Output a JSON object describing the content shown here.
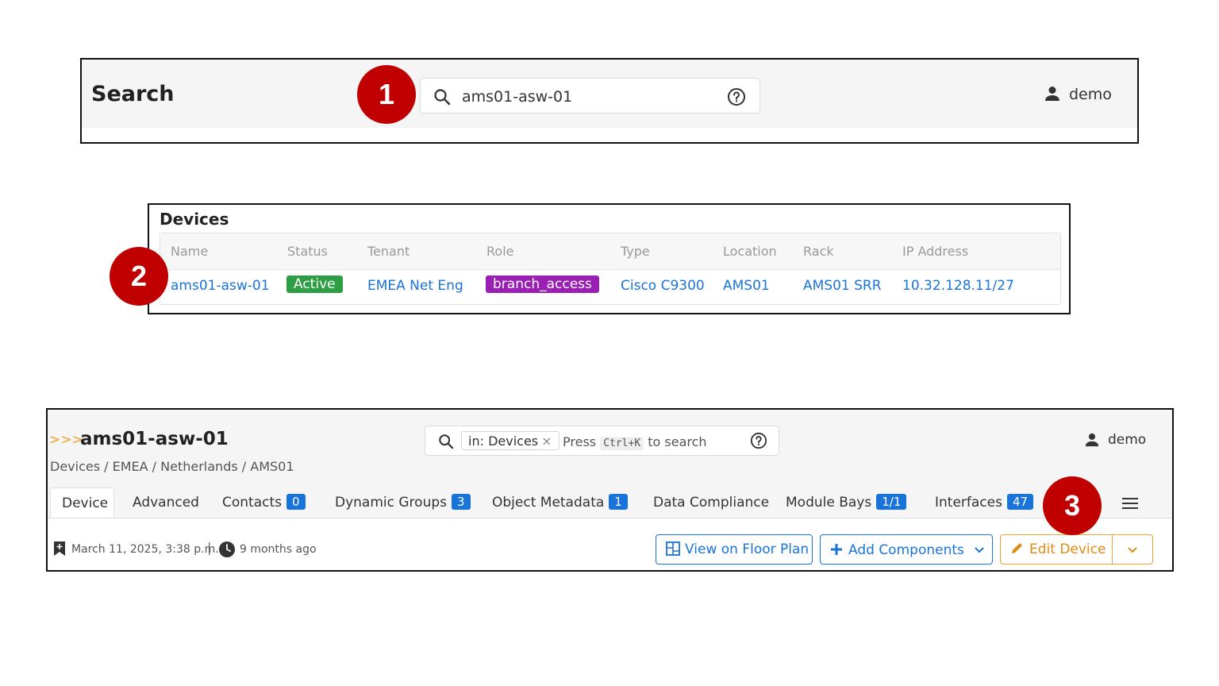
{
  "markers": [
    "1",
    "2",
    "3"
  ],
  "search_page": {
    "title": "Search",
    "search_value": "ams01-asw-01",
    "user": "demo"
  },
  "devices_table": {
    "title": "Devices",
    "columns": [
      "Name",
      "Status",
      "Tenant",
      "Role",
      "Type",
      "Location",
      "Rack",
      "IP Address"
    ],
    "row": {
      "name": "ams01-asw-01",
      "status": "Active",
      "tenant": "EMEA Net Eng",
      "role": "branch_access",
      "type": "Cisco C9300",
      "location": "AMS01",
      "rack": "AMS01 SRR",
      "ip_address": "10.32.128.11/27"
    }
  },
  "device_page": {
    "chevrons": ">>>",
    "title": "ams01-asw-01",
    "breadcrumb": "Devices / EMEA / Netherlands / AMS01",
    "search": {
      "chip": "in: Devices",
      "chip_close": "×",
      "hint_press": "Press",
      "hint_key": "Ctrl+K",
      "hint_rest": "to search"
    },
    "user": "demo",
    "tabs": [
      {
        "label": "Device",
        "count": null
      },
      {
        "label": "Advanced",
        "count": null
      },
      {
        "label": "Contacts",
        "count": "0"
      },
      {
        "label": "Dynamic Groups",
        "count": "3"
      },
      {
        "label": "Object Metadata",
        "count": "1"
      },
      {
        "label": "Data Compliance",
        "count": null
      },
      {
        "label": "Module Bays",
        "count": "1/1"
      },
      {
        "label": "Interfaces",
        "count": "47"
      }
    ],
    "created": "March 11, 2025, 3:38 p.m.",
    "separator": "|",
    "updated": "9 months ago",
    "buttons": {
      "floor_plan": "View on Floor Plan",
      "add_components": "Add Components",
      "edit_device": "Edit Device"
    }
  },
  "colors": {
    "marker": "#c00000",
    "link": "#1a73d9",
    "status_active": "#2e9e44",
    "role_badge": "#9b1fb5",
    "edit_orange": "#f0a030"
  }
}
